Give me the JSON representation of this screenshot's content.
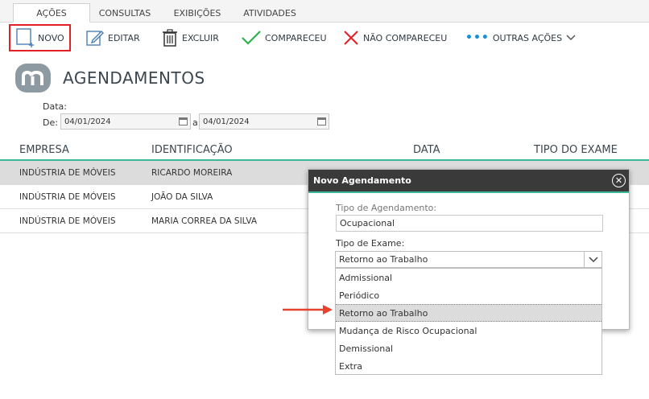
{
  "tabs": [
    "AÇÕES",
    "CONSULTAS",
    "EXIBIÇÕES",
    "ATIVIDADES"
  ],
  "toolbar": {
    "novo": "NOVO",
    "editar": "EDITAR",
    "excluir": "EXCLUIR",
    "compareceu": "COMPARECEU",
    "nao_compareceu": "NÃO COMPARECEU",
    "outras_acoes": "OUTRAS AÇÕES"
  },
  "page": {
    "title": "AGENDAMENTOS",
    "date_label": "Data:",
    "de_label": "De:",
    "a_label": "a",
    "date_from": "04/01/2024",
    "date_to": "04/01/2024"
  },
  "table": {
    "headers": [
      "EMPRESA",
      "IDENTIFICAÇÃO",
      "DATA",
      "TIPO DO EXAME"
    ],
    "rows": [
      [
        "INDÚSTRIA DE MÓVEIS",
        "RICARDO MOREIRA"
      ],
      [
        "INDÚSTRIA DE MÓVEIS",
        "JOÃO DA SILVA"
      ],
      [
        "INDÚSTRIA DE MÓVEIS",
        "MARIA CORREA DA SILVA"
      ]
    ]
  },
  "dialog": {
    "title": "Novo Agendamento",
    "tipo_agendamento_label": "Tipo de Agendamento:",
    "tipo_agendamento_value": "Ocupacional",
    "tipo_exame_label": "Tipo de Exame:",
    "tipo_exame_value": "Retorno ao Trabalho",
    "options": [
      "Admissional",
      "Periódico",
      "Retorno ao Trabalho",
      "Mudança de Risco Ocupacional",
      "Demissional",
      "Extra"
    ],
    "highlighted_option": "Retorno ao Trabalho"
  },
  "colors": {
    "accent_green": "#3fb89a",
    "highlight_red": "#e32026",
    "icon_blue": "#1a8fd2",
    "icon_green": "#2bb34a"
  }
}
